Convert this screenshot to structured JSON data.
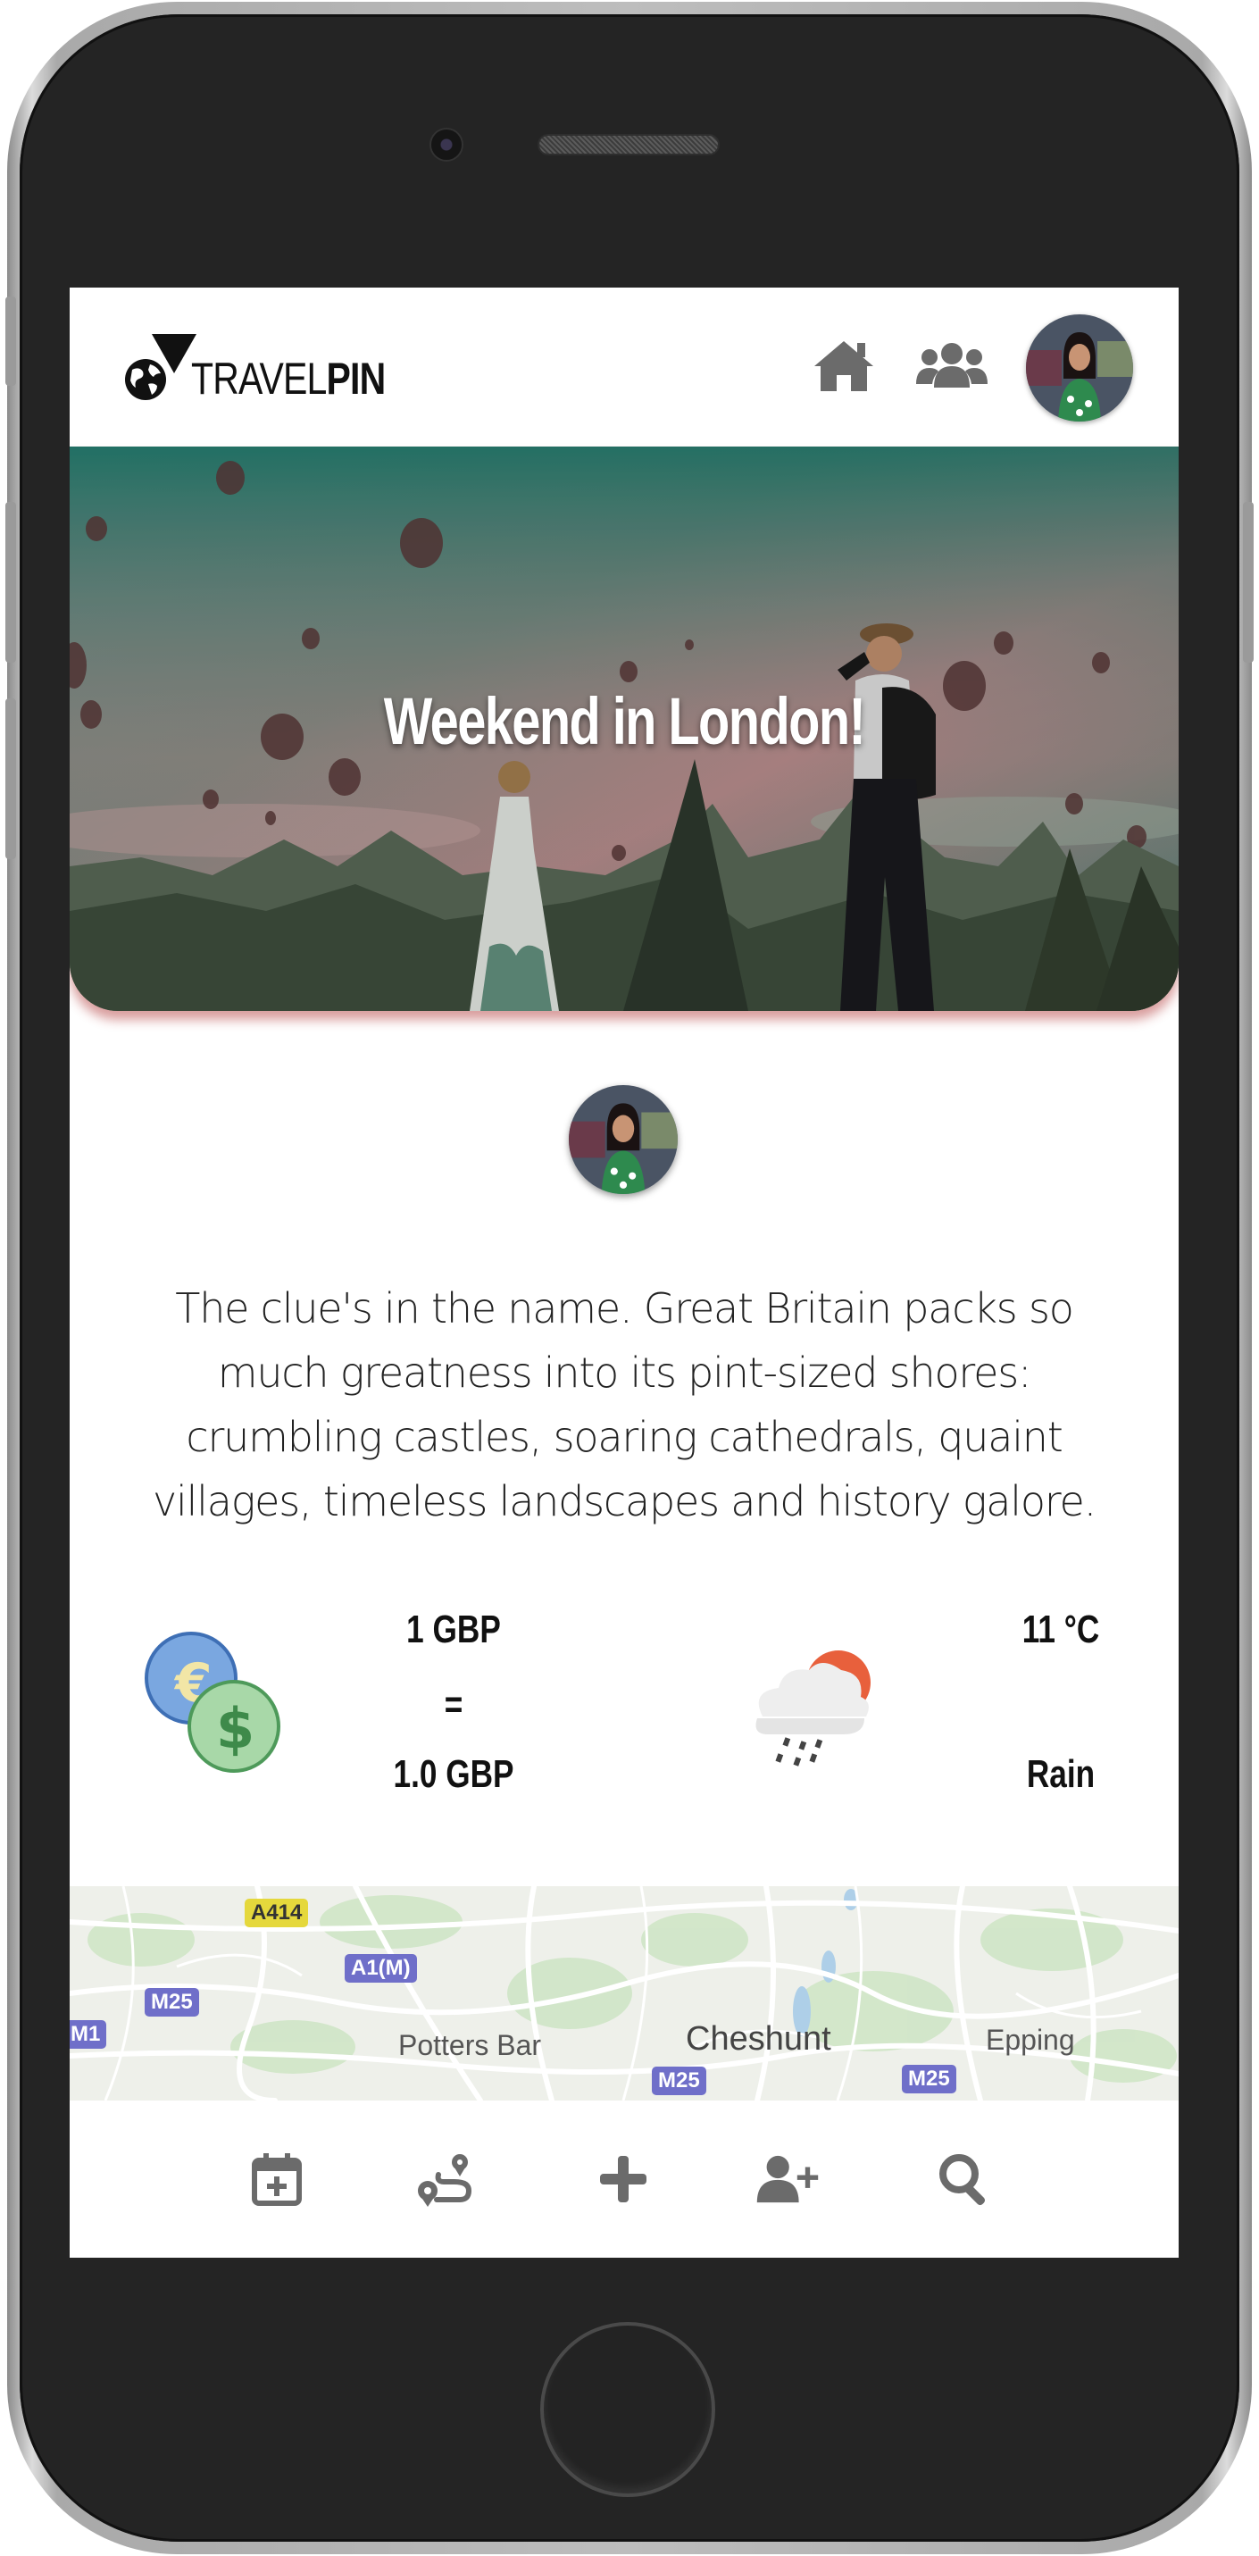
{
  "app": {
    "logo_text_light": "TRAVEL",
    "logo_text_bold": "PIN",
    "logo_icon": "globe-pin-icon"
  },
  "header": {
    "icons": [
      "home-icon",
      "users-icon"
    ],
    "profile_avatar": "user-avatar"
  },
  "hero": {
    "title": "Weekend in London!",
    "image": "hot-air-balloons-travellers-photo"
  },
  "post": {
    "author_avatar": "user-avatar",
    "description": "The clue's in the name. Great Britain packs so much greatness into its pint-sized shores: crumbling castles, soaring cathedrals, quaint villages, timeless landscapes and history galore."
  },
  "currency": {
    "icon": "currency-exchange-icon",
    "from": "1 GBP",
    "equals": "=",
    "to": "1.0 GBP"
  },
  "weather": {
    "icon": "rain-sun-cloud-icon",
    "temperature": "11 °C",
    "condition": "Rain"
  },
  "map": {
    "places": [
      "Potters Bar",
      "Cheshunt",
      "Epping"
    ],
    "road_badges": [
      "A414",
      "A1(M)",
      "M25",
      "M1",
      "M25",
      "M25"
    ]
  },
  "bottom_nav": {
    "icons": [
      "calendar-plus-icon",
      "route-icon",
      "plus-icon",
      "add-user-icon",
      "search-icon"
    ]
  },
  "colors": {
    "icon_gray": "#6b6b6b",
    "hero_shadow": "#aa2828",
    "coin_euro": "#7aa7e0",
    "coin_dollar": "#a8d8a8",
    "sun": "#e8603c",
    "map_badge": "#6f6fc9"
  }
}
